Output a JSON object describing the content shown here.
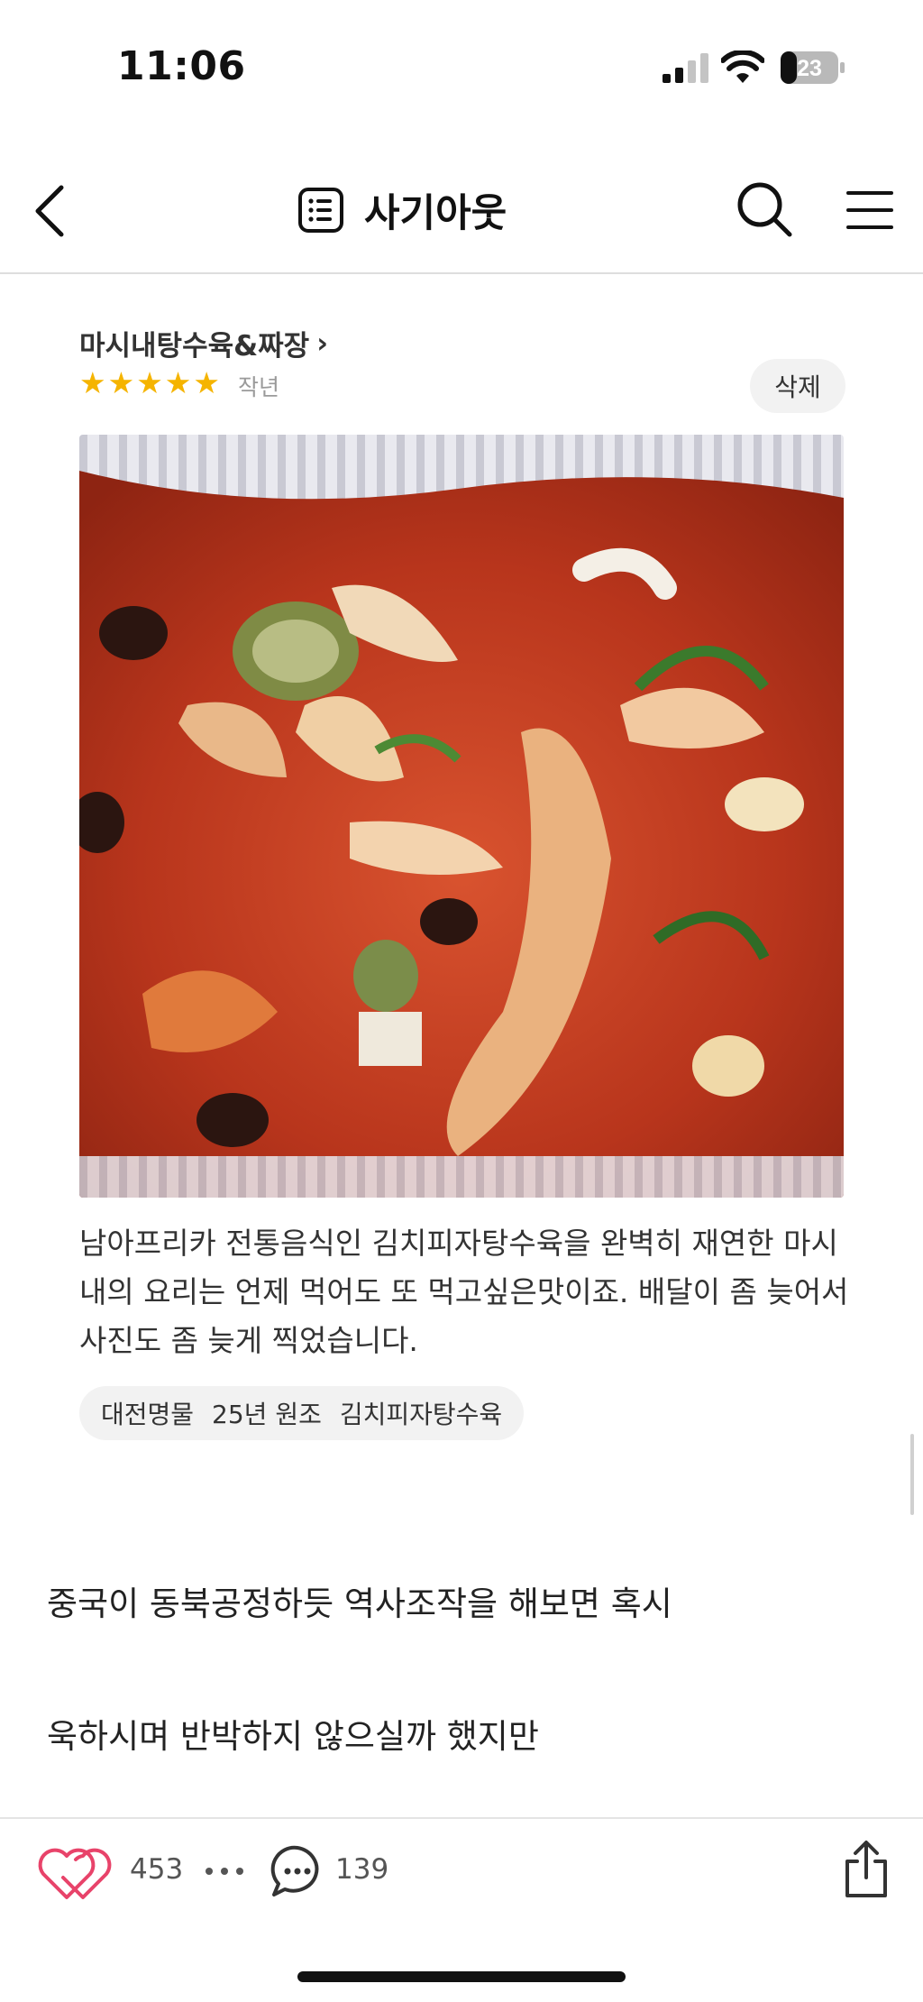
{
  "status_bar": {
    "time": "11:06",
    "battery_level": "23"
  },
  "nav": {
    "title": "사기아웃"
  },
  "review": {
    "store_name": "마시내탕수육&짜장",
    "store_chevron": "›",
    "rating": 5,
    "stars": [
      "★",
      "★",
      "★",
      "★",
      "★"
    ],
    "date": "작년",
    "delete_label": "삭제",
    "text": "남아프리카 전통음식인 김치피자탕수육을 완벽히 재연한 마시내의 요리는 언제 먹어도 또 먹고싶은맛이죠. 배달이 좀 늦어서 사진도 좀 늦게 찍었습니다.",
    "tags": [
      "대전명물",
      "25년 원조",
      "김치피자탕수육"
    ]
  },
  "post": {
    "lines": [
      "중국이 동북공정하듯 역사조작을 해보면 혹시",
      "욱하시며 반박하지 않으실까 했지만"
    ]
  },
  "bottom_bar": {
    "like_count": "453",
    "comment_count": "139"
  },
  "colors": {
    "star": "#f5b400",
    "like_heart": "#e8436a",
    "pill_bg": "#f2f2f2"
  },
  "icons": [
    "signal-icon",
    "wifi-icon",
    "battery-icon",
    "back-arrow-icon",
    "list-icon",
    "search-icon",
    "menu-icon",
    "heart-icon",
    "more-dots-icon",
    "comment-icon",
    "share-icon"
  ]
}
